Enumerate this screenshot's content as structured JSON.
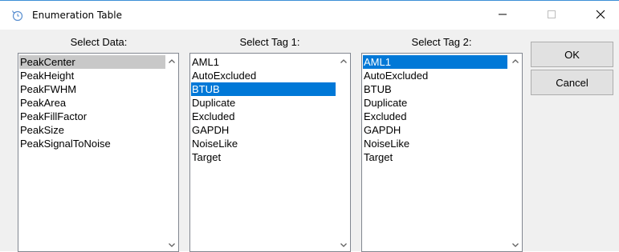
{
  "window": {
    "title": "Enumeration Table",
    "icon": "app-icon",
    "controls": {
      "minimize": "minimize-icon",
      "maximize": "maximize-icon",
      "close": "close-icon"
    }
  },
  "columns": {
    "data": {
      "label": "Select Data:",
      "items": [
        "PeakCenter",
        "PeakHeight",
        "PeakFWHM",
        "PeakArea",
        "PeakFillFactor",
        "PeakSize",
        "PeakSignalToNoise"
      ],
      "selected": "PeakCenter"
    },
    "tag1": {
      "label": "Select Tag 1:",
      "items": [
        "AML1",
        "AutoExcluded",
        "BTUB",
        "Duplicate",
        "Excluded",
        "GAPDH",
        "NoiseLike",
        "Target"
      ],
      "selected": "BTUB"
    },
    "tag2": {
      "label": "Select Tag 2:",
      "items": [
        "AML1",
        "AutoExcluded",
        "BTUB",
        "Duplicate",
        "Excluded",
        "GAPDH",
        "NoiseLike",
        "Target"
      ],
      "selected": "AML1"
    }
  },
  "buttons": {
    "ok": "OK",
    "cancel": "Cancel"
  },
  "colors": {
    "selection": "#0078d7",
    "inactive_selection": "#c8c8c8",
    "window_bg": "#f0f0f0"
  }
}
